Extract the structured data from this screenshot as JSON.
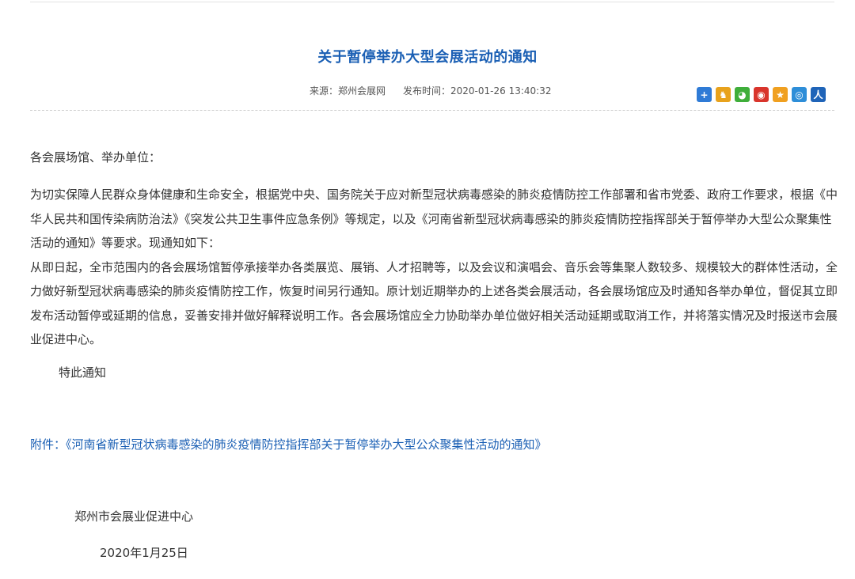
{
  "article": {
    "title": "关于暂停举办大型会展活动的通知",
    "source": "来源：郑州会展网",
    "publish_time": "发布时间：2020-01-26 13:40:32"
  },
  "share_icons": [
    {
      "name": "share-more-icon",
      "glyph": "+",
      "color": "#2f7bd6"
    },
    {
      "name": "qq-icon",
      "glyph": "♞",
      "color": "#e8a21c"
    },
    {
      "name": "wechat-icon",
      "glyph": "◕",
      "color": "#3fae3a"
    },
    {
      "name": "weibo-icon",
      "glyph": "◉",
      "color": "#d9352c"
    },
    {
      "name": "qzone-icon",
      "glyph": "★",
      "color": "#f0a020"
    },
    {
      "name": "tencent-weibo-icon",
      "glyph": "◎",
      "color": "#2e8ed8"
    },
    {
      "name": "renren-icon",
      "glyph": "人",
      "color": "#1f64b8"
    }
  ],
  "content": {
    "greeting": "各会展场馆、举办单位：",
    "paragraph1": "为切实保障人民群众身体健康和生命安全，根据党中央、国务院关于应对新型冠状病毒感染的肺炎疫情防控工作部署和省市党委、政府工作要求，根据《中华人民共和国传染病防治法》《突发公共卫生事件应急条例》等规定，以及《河南省新型冠状病毒感染的肺炎疫情防控指挥部关于暂停举办大型公众聚集性活动的通知》等要求。现通知如下：",
    "paragraph2": "从即日起，全市范围内的各会展场馆暂停承接举办各类展览、展销、人才招聘等，以及会议和演唱会、音乐会等集聚人数较多、规模较大的群体性活动，全力做好新型冠状病毒感染的肺炎疫情防控工作，恢复时间另行通知。原计划近期举办的上述各类会展活动，各会展场馆应及时通知各举办单位，督促其立即发布活动暂停或延期的信息，妥善安排并做好解释说明工作。各会展场馆应全力协助举办单位做好相关活动延期或取消工作，并将落实情况及时报送市会展业促进中心。",
    "special_notice": "特此通知",
    "attachment_label": "附件：",
    "attachment_link": "《河南省新型冠状病毒感染的肺炎疫情防控指挥部关于暂停举办大型公众聚集性活动的通知》",
    "signature_org": "郑州市会展业促进中心",
    "signature_date": "2020年1月25日"
  },
  "colors": {
    "title": "#1a5fb4",
    "link": "#1a5fb4",
    "text": "#333333"
  }
}
